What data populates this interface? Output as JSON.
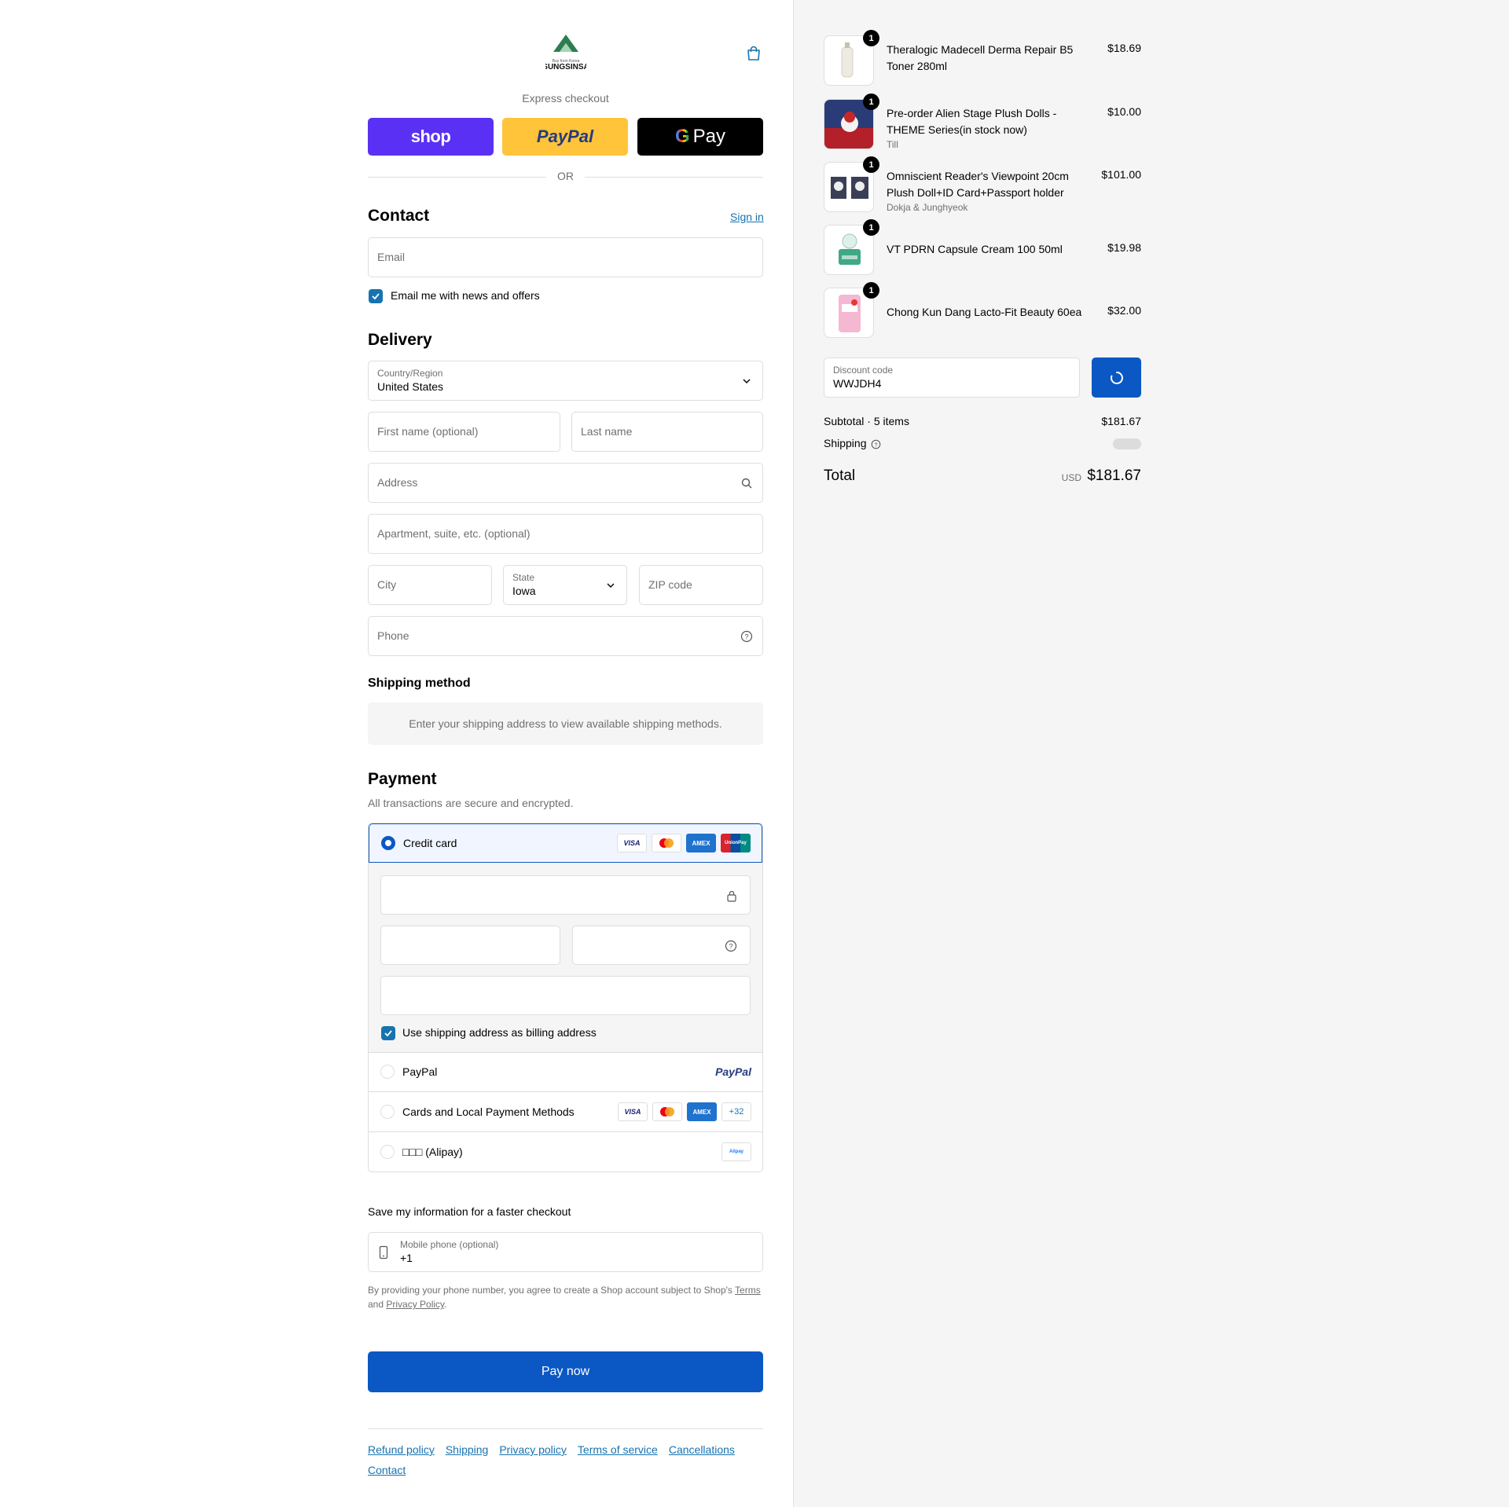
{
  "brand": {
    "logo_text": "SUNGSINSA",
    "logo_subtext": "Buy from Korea"
  },
  "express": {
    "title": "Express checkout",
    "shop_label": "shop",
    "paypal_label": "PayPal",
    "gpay_label": "Pay",
    "or_label": "OR"
  },
  "contact": {
    "heading": "Contact",
    "sign_in": "Sign in",
    "email_placeholder": "Email",
    "news_label": "Email me with news and offers"
  },
  "delivery": {
    "heading": "Delivery",
    "country_label": "Country/Region",
    "country_value": "United States",
    "first_name_placeholder": "First name (optional)",
    "last_name_placeholder": "Last name",
    "address_placeholder": "Address",
    "apartment_placeholder": "Apartment, suite, etc. (optional)",
    "city_placeholder": "City",
    "state_label": "State",
    "state_value": "Iowa",
    "zip_placeholder": "ZIP code",
    "phone_placeholder": "Phone"
  },
  "shipping_method": {
    "heading": "Shipping method",
    "message": "Enter your shipping address to view available shipping methods."
  },
  "payment": {
    "heading": "Payment",
    "subtitle": "All transactions are secure and encrypted.",
    "credit_card_label": "Credit card",
    "billing_label": "Use shipping address as billing address",
    "paypal_label": "PayPal",
    "paypal_logo": "PayPal",
    "local_label": "Cards and Local Payment Methods",
    "local_more": "+32",
    "alipay_label": "□□□ (Alipay)",
    "alipay_logo": "Alipay",
    "card_visa": "VISA",
    "card_amex": "AMEX",
    "card_unionpay": "UnionPay"
  },
  "save_info": {
    "heading": "Save my information for a faster checkout",
    "mobile_label": "Mobile phone (optional)",
    "mobile_value": "+1",
    "legal_prefix": "By providing your phone number, you agree to create a Shop account subject to Shop's ",
    "legal_terms": "Terms",
    "legal_and": "and ",
    "legal_privacy": "Privacy Policy",
    "legal_end": "."
  },
  "pay_now": "Pay now",
  "footer_links": [
    "Refund policy",
    "Shipping",
    "Privacy policy",
    "Terms of service",
    "Cancellations",
    "Contact"
  ],
  "order": {
    "items": [
      {
        "name": "Theralogic Madecell Derma Repair B5 Toner 280ml",
        "variant": "",
        "price": "$18.69",
        "qty": "1",
        "thumb_color": "#eeeae2"
      },
      {
        "name": "Pre-order Alien Stage Plush Dolls - THEME Series(in stock now)",
        "variant": "Till",
        "price": "$10.00",
        "qty": "1",
        "thumb_color": "#2a3c78"
      },
      {
        "name": "Omniscient Reader's Viewpoint 20cm Plush Doll+ID Card+Passport holder",
        "variant": "Dokja & Junghyeok",
        "price": "$101.00",
        "qty": "1",
        "thumb_color": "#e8e8ee"
      },
      {
        "name": "VT PDRN Capsule Cream 100 50ml",
        "variant": "",
        "price": "$19.98",
        "qty": "1",
        "thumb_color": "#dff0ea"
      },
      {
        "name": "Chong Kun Dang Lacto-Fit Beauty 60ea",
        "variant": "",
        "price": "$32.00",
        "qty": "1",
        "thumb_color": "#f4b8d3"
      }
    ],
    "discount_label": "Discount code",
    "discount_value": "WWJDH4",
    "subtotal_label": "Subtotal · 5 items",
    "subtotal_value": "$181.67",
    "shipping_label": "Shipping",
    "total_label": "Total",
    "total_currency": "USD",
    "total_value": "$181.67"
  },
  "colors": {
    "accent": "#0b58c4",
    "link": "#1773b0",
    "shop": "#5a31f4",
    "paypal": "#ffc439"
  }
}
